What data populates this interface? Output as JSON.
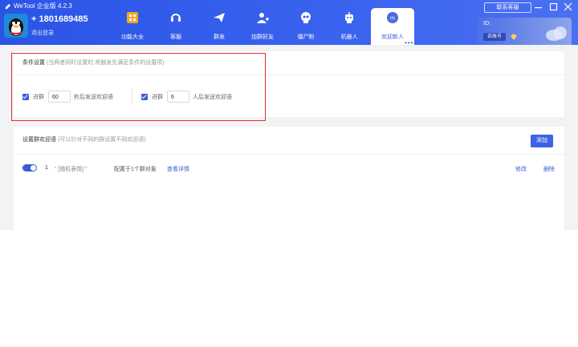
{
  "app": {
    "title": "WeTool 企业版 4.2.3"
  },
  "account": {
    "number": "+ 1801689485",
    "logout_label": "退出登录"
  },
  "nav": {
    "items": [
      {
        "label": "功能大全",
        "icon": "grid-icon"
      },
      {
        "label": "客服",
        "icon": "headset-icon"
      },
      {
        "label": "群发",
        "icon": "send-icon"
      },
      {
        "label": "加群好友",
        "icon": "add-friend-icon"
      },
      {
        "label": "僵尸粉",
        "icon": "skull-icon"
      },
      {
        "label": "机器人",
        "icon": "robot-icon"
      },
      {
        "label": "欢迎新人",
        "icon": "chat-icon",
        "active": true
      }
    ]
  },
  "topright": {
    "contact_label": "联系客服",
    "id_label": "ID:",
    "id_badge": "去账号"
  },
  "conditions": {
    "title": "条件设置",
    "hint": "(当两者同时设置时,将触发先满足条件的设置项)",
    "rule1": {
      "prefix": "进群",
      "value": "60",
      "suffix": "秒后发送欢迎语"
    },
    "rule2": {
      "prefix": "进群",
      "value": "6",
      "suffix": "人后发送欢迎语"
    }
  },
  "welcome": {
    "title": "设置群欢迎语",
    "hint": "(可以针对不同的群设置不同欢迎语)",
    "add_label": "添加",
    "rows": [
      {
        "index": "1",
        "name": "“ [随机表情] ”",
        "config": "配置于1个群对象",
        "detail": "查看详情",
        "edit": "修改",
        "delete": "删除"
      }
    ]
  },
  "colors": {
    "accent": "#3b5bdb",
    "header": "#2b54e6",
    "highlight": "#e0302a"
  }
}
